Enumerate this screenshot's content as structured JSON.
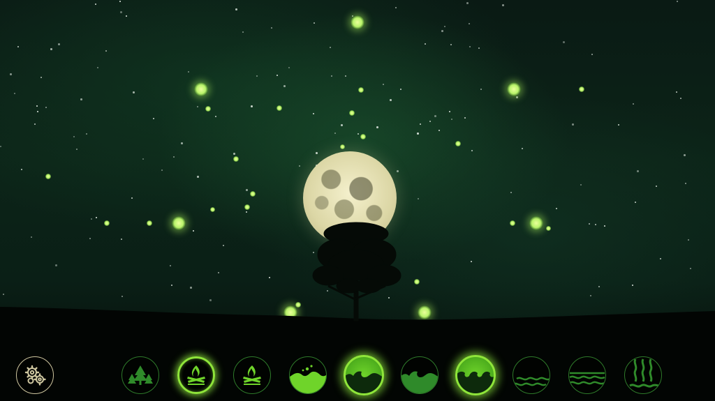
{
  "colors": {
    "accent": "#8fe53a",
    "accent_dark": "#2e7a2a",
    "firefly": "#c6f57a",
    "moon": "#e8e4b8",
    "settings_ring": "#cfc7a0"
  },
  "toolbar": {
    "settings": {
      "icon": "gears-icon"
    },
    "sound_buttons": [
      {
        "icon": "forest-icon",
        "state": "off"
      },
      {
        "icon": "campfire-icon",
        "state": "active"
      },
      {
        "icon": "campfire-icon",
        "state": "off"
      },
      {
        "icon": "water-splash-icon",
        "state": "off"
      },
      {
        "icon": "waves-icon",
        "state": "lit"
      },
      {
        "icon": "waves-icon",
        "state": "off"
      },
      {
        "icon": "ocean-waves-icon",
        "state": "lit"
      },
      {
        "icon": "water-ripple-icon",
        "state": "off"
      },
      {
        "icon": "river-icon",
        "state": "off"
      },
      {
        "icon": "waterfall-icon",
        "state": "off"
      }
    ]
  }
}
